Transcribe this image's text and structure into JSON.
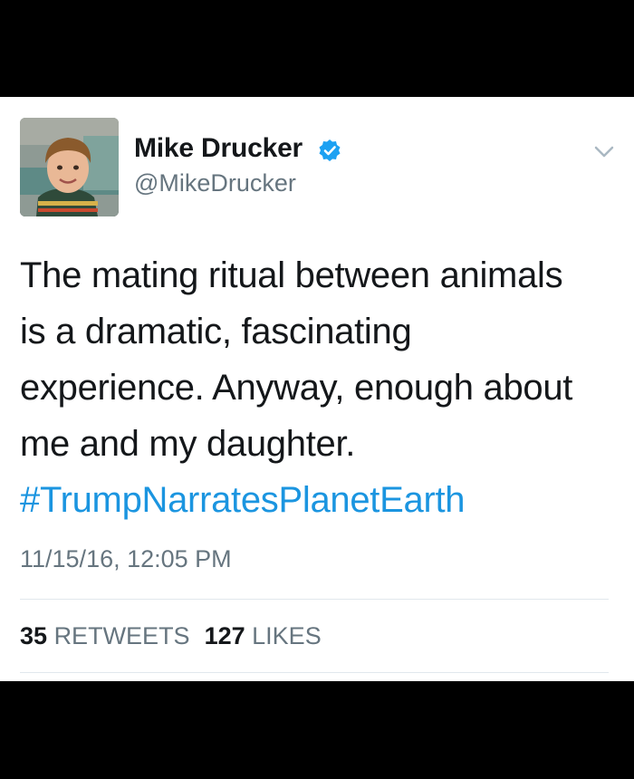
{
  "tweet": {
    "author": {
      "display_name": "Mike Drucker",
      "handle": "@MikeDrucker",
      "verified": true,
      "avatar_icon": "profile-photo"
    },
    "text_lines": [
      "The mating ritual between animals",
      "is a dramatic, fascinating",
      "experience. Anyway, enough about",
      "me and my daughter."
    ],
    "hashtag": "#TrumpNarratesPlanetEarth",
    "timestamp": "11/15/16, 12:05 PM",
    "stats": {
      "retweets_count": "35",
      "retweets_label": "RETWEETS",
      "likes_count": "127",
      "likes_label": "LIKES"
    },
    "menu_icon": "chevron-down-icon"
  },
  "colors": {
    "background": "#000000",
    "card": "#ffffff",
    "text": "#14171a",
    "secondary": "#66757f",
    "link": "#1b95e0",
    "verified_badge": "#1da1f2",
    "divider": "#e1e8ed"
  }
}
